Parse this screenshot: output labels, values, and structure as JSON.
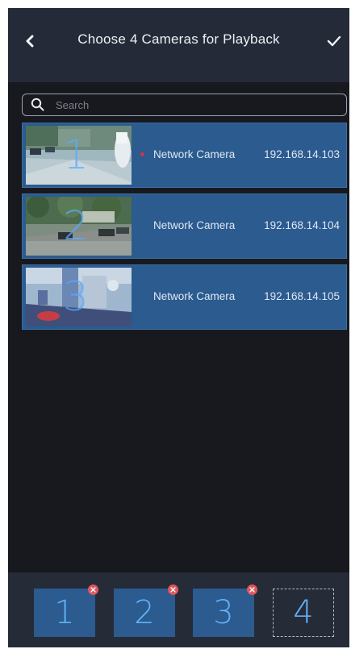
{
  "header": {
    "title": "Choose 4 Cameras for Playback",
    "back_icon": "chevron-left-icon",
    "confirm_icon": "check-icon"
  },
  "search": {
    "placeholder": "Search",
    "value": "",
    "icon": "search-icon"
  },
  "cameras": [
    {
      "number": "1",
      "name": "Network Camera",
      "ip": "192.168.14.103",
      "recording": true
    },
    {
      "number": "2",
      "name": "Network Camera",
      "ip": "192.168.14.104",
      "recording": false
    },
    {
      "number": "3",
      "name": "Network Camera",
      "ip": "192.168.14.105",
      "recording": false
    }
  ],
  "slots": [
    {
      "label": "1",
      "filled": true
    },
    {
      "label": "2",
      "filled": true
    },
    {
      "label": "3",
      "filled": true
    },
    {
      "label": "4",
      "filled": false
    }
  ],
  "colors": {
    "background": "#17191f",
    "header": "#242a38",
    "row": "#2b5b8f",
    "accent_number": "#62b0f5",
    "remove_badge": "#e0565e",
    "recording_dot": "#d3324d"
  }
}
